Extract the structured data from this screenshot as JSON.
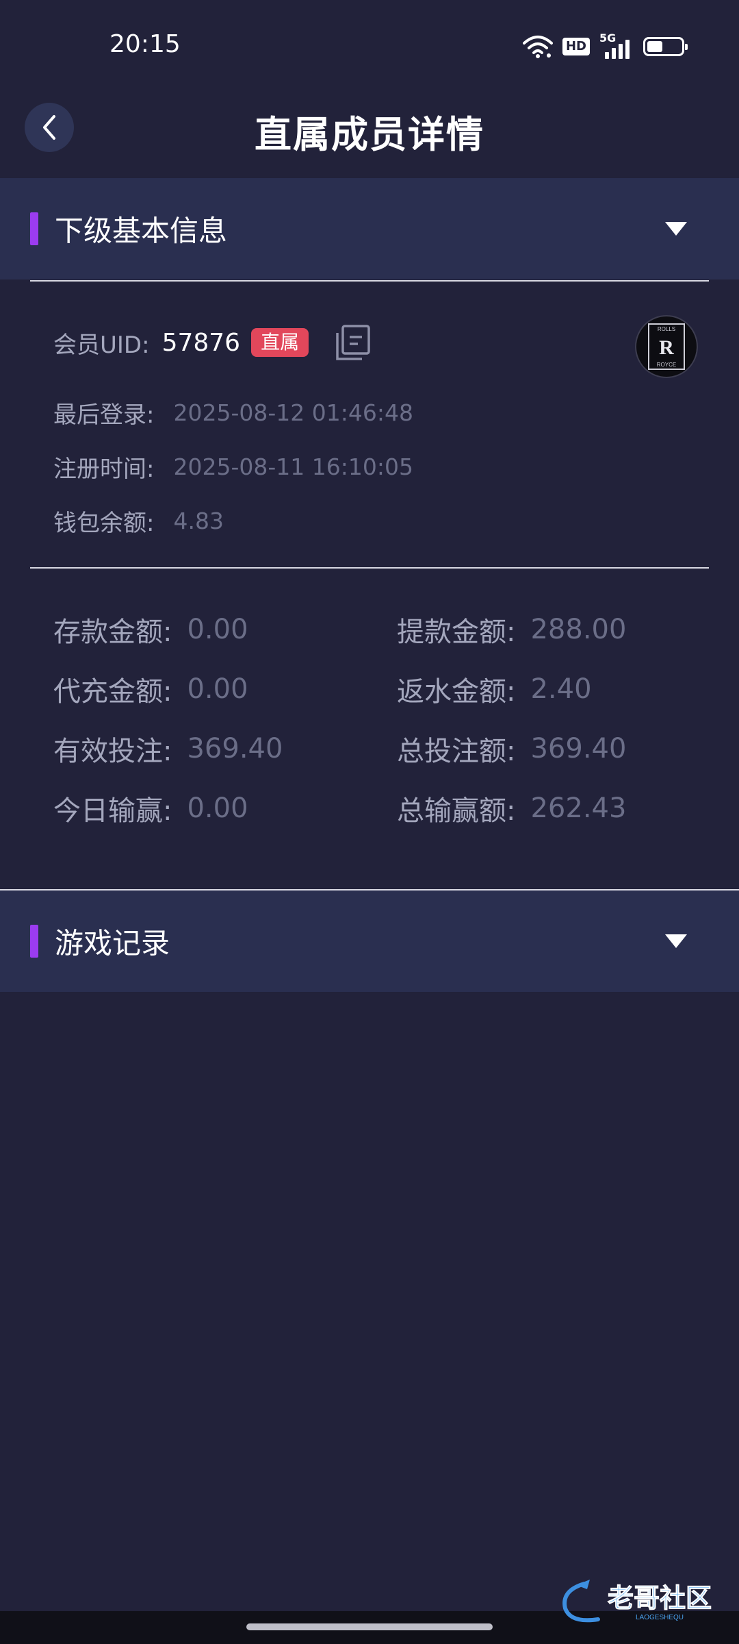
{
  "status_bar": {
    "time": "20:15",
    "icons": [
      "wifi-icon",
      "hd-icon",
      "5g-signal-icon",
      "battery-icon"
    ],
    "hd_label": "HD",
    "network_label": "5G",
    "battery_level": 0.45
  },
  "header": {
    "title": "直属成员详情",
    "back_icon": "chevron-left-icon"
  },
  "basic_info": {
    "section_title": "下级基本信息",
    "uid_label": "会员UID:",
    "uid_value": "57876",
    "uid_badge": "直属",
    "avatar_text": [
      "ROLLS",
      "ROYCE"
    ],
    "last_login_label": "最后登录:",
    "last_login_value": "2025-08-12 01:46:48",
    "register_label": "注册时间:",
    "register_value": "2025-08-11 16:10:05",
    "wallet_label": "钱包余额:",
    "wallet_value": "4.83"
  },
  "stats": [
    {
      "label": "存款金额:",
      "value": "0.00"
    },
    {
      "label": "提款金额:",
      "value": "288.00"
    },
    {
      "label": "代充金额:",
      "value": "0.00"
    },
    {
      "label": "返水金额:",
      "value": "2.40"
    },
    {
      "label": "有效投注:",
      "value": "369.40"
    },
    {
      "label": "总投注额:",
      "value": "369.40"
    },
    {
      "label": "今日输赢:",
      "value": "0.00"
    },
    {
      "label": "总输赢额:",
      "value": "262.43"
    }
  ],
  "game_records": {
    "section_title": "游戏记录"
  },
  "watermark": {
    "text": "老哥社区",
    "subtext": "LAOGESHEQU"
  },
  "colors": {
    "background": "#22223a",
    "section_bg": "#2a2f50",
    "accent_bar": "#9b3cf0",
    "badge": "#e2475b"
  }
}
